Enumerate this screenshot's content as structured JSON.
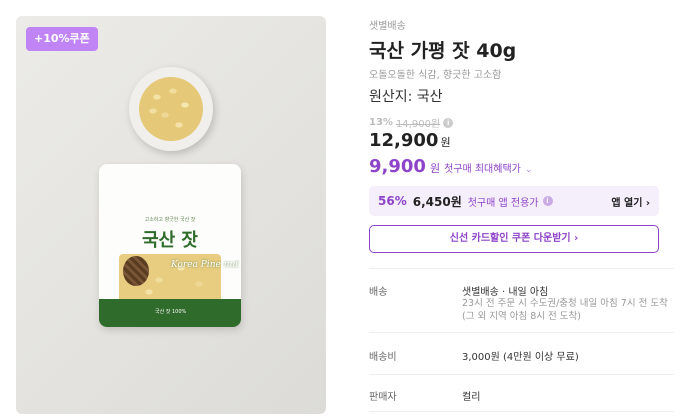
{
  "image": {
    "coupon_badge": "+10%쿠폰",
    "pouch_topline": "고소하고 향긋한 국산 잣",
    "pouch_title": "국산 잣",
    "pouch_script": "Korea Pine nut",
    "pouch_bottom": "국산 잣 100%"
  },
  "product": {
    "delivery_tag": "샛별배송",
    "name": "국산 가평 잣 40g",
    "subtitle": "오돌오돌한 식감, 향긋한 고소함",
    "origin": "원산지: 국산"
  },
  "pricing": {
    "discount_rate": "13%",
    "original_price": "14,900원",
    "price": "12,900",
    "price_unit": "원",
    "first_purchase_price": "9,900",
    "first_purchase_unit": "원",
    "first_purchase_label": "첫구매 최대혜택가",
    "app_rate": "56%",
    "app_price": "6,450원",
    "app_label": "첫구매 앱 전용가",
    "app_open": "앱 열기 ›",
    "coupon_button": "신선 카드할인 쿠폰 다운받기 ›"
  },
  "specs": {
    "delivery_label": "배송",
    "delivery_value": "샛별배송 · 내일 아침",
    "delivery_desc": "23시 전 주문 시 수도권/충청 내일 아침 7시 전 도착 (그 외 지역 아침 8시 전 도착)",
    "fee_label": "배송비",
    "fee_value": "3,000원 (4만원 이상 무료)",
    "seller_label": "판매자",
    "seller_value": "컬리"
  },
  "icons": {
    "info": "info-icon",
    "chevron_down": "chevron-down-icon"
  },
  "colors": {
    "accent_purple": "#8e44c9",
    "badge_purple": "#c084f5",
    "app_box_bg": "#f5effc"
  }
}
